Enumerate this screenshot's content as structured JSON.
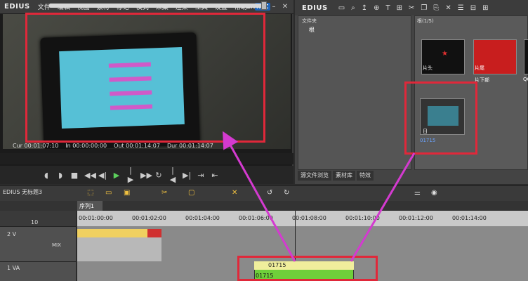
{
  "player": {
    "app": "EDIUS",
    "menu": [
      "文件",
      "编辑",
      "视图",
      "素材",
      "标记",
      "模式",
      "采集",
      "渲染",
      "工具",
      "设置",
      "帮助"
    ],
    "plr": "PLR",
    "rec": "REC",
    "timecodes": {
      "cur": "Cur 00:01:07:10",
      "in": "In 00:00:00:00",
      "out": "Out 00:01:14:07",
      "dur": "Dur 00:01:14:07"
    }
  },
  "bin": {
    "app": "EDIUS",
    "folder_title": "文件夹",
    "folder_root": "根",
    "clip_title": "根(1/5)",
    "clips": [
      {
        "label": "片头",
        "name": ""
      },
      {
        "label": "片尾",
        "name": "片下部"
      },
      {
        "label": "",
        "name": "QQ"
      },
      {
        "label": "日",
        "name": "01715"
      }
    ],
    "tabs": [
      "源文件浏览",
      "素材库",
      "特效"
    ]
  },
  "timeline": {
    "project": "无标题3",
    "sequence": "序列1",
    "ruler": [
      "00:01:00:00",
      "00:01:02:00",
      "00:01:04:00",
      "00:01:06:00",
      "00:01:08:00",
      "00:01:10:00",
      "00:01:12:00",
      "00:01:14:00"
    ],
    "tracks": [
      {
        "id": "2 V",
        "mix": "MIX"
      },
      {
        "id": "1 VA",
        "mix": ""
      }
    ],
    "zoom": "10",
    "clip_name": "01715"
  }
}
